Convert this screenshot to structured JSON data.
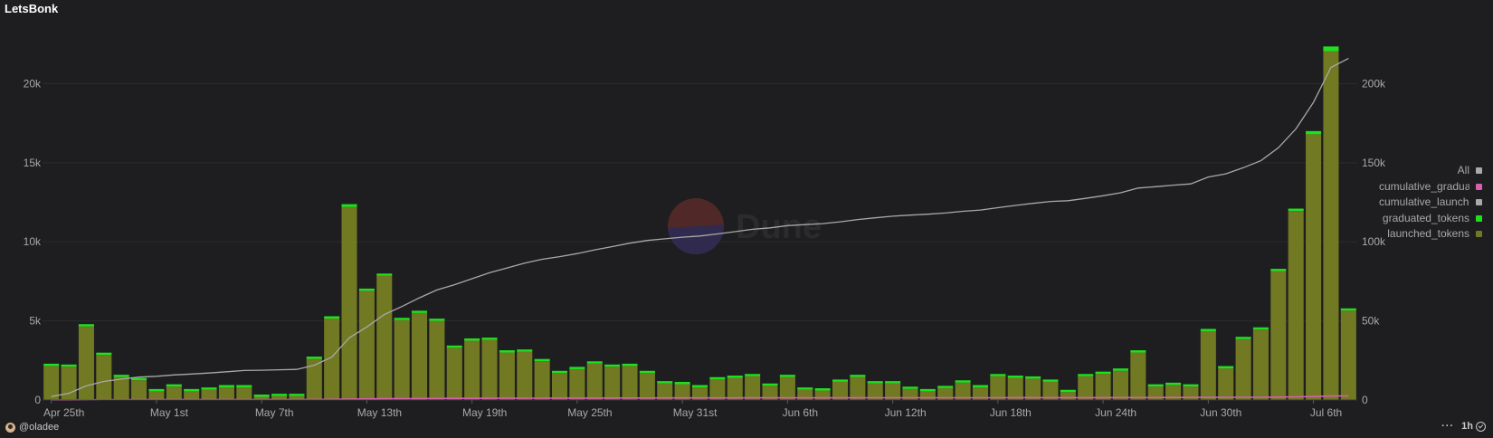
{
  "header": {
    "title": "LetsBonk"
  },
  "watermark": {
    "text": "Dune"
  },
  "footer": {
    "author": "@oladee",
    "more_label": "···",
    "refresh_label": "1h"
  },
  "colors": {
    "background": "#1e1e20",
    "launched": "#717922",
    "graduated": "#1fe01f",
    "cumulative_launched": "#a9a9a9",
    "cumulative_graduated": "#d85fb0",
    "all": "#a9a9a9"
  },
  "legend": [
    {
      "label": "All",
      "color": "#a9a9a9"
    },
    {
      "label": "cumulative_graduated_tokens",
      "color": "#d85fb0"
    },
    {
      "label": "cumulative_launched_tokens",
      "color": "#a9a9a9"
    },
    {
      "label": "graduated_tokens",
      "color": "#1fe01f"
    },
    {
      "label": "launched_tokens",
      "color": "#717922"
    }
  ],
  "chart_data": {
    "type": "bar",
    "stacked": true,
    "x_start_date": "2025-04-25",
    "x_tick_labels": [
      "Apr 25th",
      "May 1st",
      "May 7th",
      "May 13th",
      "May 19th",
      "May 25th",
      "May 31st",
      "Jun 6th",
      "Jun 12th",
      "Jun 18th",
      "Jun 24th",
      "Jun 30th",
      "Jul 6th"
    ],
    "y_left_ticks": [
      "0",
      "5k",
      "10k",
      "15k",
      "20k"
    ],
    "y_left_range": [
      0,
      23000
    ],
    "y_right_ticks": [
      "0",
      "50k",
      "100k",
      "150k",
      "200k"
    ],
    "y_right_range": [
      0,
      230000
    ],
    "grid": true,
    "legend_position": "right",
    "series": [
      {
        "name": "launched_tokens",
        "axis": "left",
        "values": [
          2150,
          2100,
          4650,
          2850,
          1450,
          1250,
          550,
          850,
          550,
          650,
          800,
          800,
          200,
          250,
          250,
          2600,
          5150,
          12200,
          6900,
          7850,
          5050,
          5500,
          5000,
          3300,
          3750,
          3800,
          3000,
          3050,
          2450,
          1700,
          1950,
          2300,
          2100,
          2150,
          1700,
          1050,
          1000,
          800,
          1300,
          1400,
          1500,
          900,
          1450,
          650,
          600,
          1150,
          1450,
          1050,
          1050,
          700,
          550,
          750,
          1100,
          800,
          1500,
          1400,
          1350,
          1150,
          500,
          1500,
          1650,
          1850,
          3000,
          850,
          950,
          850,
          4350,
          2000,
          3850,
          4450,
          8150,
          11950,
          16800,
          22050,
          5650
        ]
      },
      {
        "name": "graduated_tokens",
        "axis": "left",
        "values": [
          40,
          40,
          60,
          40,
          20,
          20,
          10,
          10,
          10,
          10,
          10,
          10,
          5,
          5,
          5,
          50,
          70,
          180,
          90,
          110,
          60,
          60,
          50,
          40,
          40,
          40,
          30,
          30,
          25,
          20,
          20,
          20,
          20,
          20,
          15,
          10,
          10,
          10,
          10,
          10,
          10,
          10,
          10,
          5,
          5,
          10,
          10,
          10,
          10,
          5,
          5,
          5,
          10,
          5,
          10,
          10,
          10,
          10,
          5,
          10,
          10,
          15,
          30,
          10,
          10,
          10,
          50,
          20,
          40,
          50,
          100,
          150,
          200,
          300,
          60
        ]
      },
      {
        "name": "cumulative_launched_tokens",
        "axis": "right",
        "values": [
          2150,
          4250,
          8900,
          11750,
          13200,
          14450,
          15000,
          15850,
          16400,
          17050,
          17850,
          18650,
          18850,
          19100,
          19350,
          21950,
          27100,
          39300,
          46200,
          54050,
          59100,
          64600,
          69600,
          72900,
          76650,
          80450,
          83450,
          86500,
          88950,
          90650,
          92600,
          94900,
          97000,
          99150,
          100850,
          101900,
          102900,
          103700,
          105000,
          106400,
          107900,
          108800,
          110250,
          110900,
          111500,
          112650,
          114100,
          115150,
          116200,
          116900,
          117450,
          118200,
          119300,
          120100,
          121600,
          123000,
          124350,
          125500,
          126000,
          127500,
          129150,
          131000,
          134000,
          134850,
          135800,
          136650,
          141000,
          143000,
          146850,
          151300,
          159450,
          171400,
          188200,
          210250,
          215900
        ]
      },
      {
        "name": "cumulative_graduated_tokens",
        "axis": "right",
        "values": [
          40,
          80,
          140,
          180,
          200,
          220,
          230,
          240,
          250,
          260,
          270,
          280,
          285,
          290,
          295,
          345,
          415,
          595,
          685,
          795,
          855,
          915,
          965,
          1005,
          1045,
          1085,
          1115,
          1145,
          1170,
          1190,
          1210,
          1230,
          1250,
          1270,
          1285,
          1295,
          1305,
          1315,
          1325,
          1335,
          1345,
          1355,
          1365,
          1370,
          1375,
          1385,
          1395,
          1405,
          1415,
          1420,
          1425,
          1430,
          1440,
          1445,
          1455,
          1465,
          1475,
          1485,
          1490,
          1500,
          1510,
          1525,
          1555,
          1565,
          1575,
          1585,
          1635,
          1655,
          1695,
          1745,
          1845,
          1995,
          2195,
          2495,
          2555
        ]
      }
    ]
  }
}
